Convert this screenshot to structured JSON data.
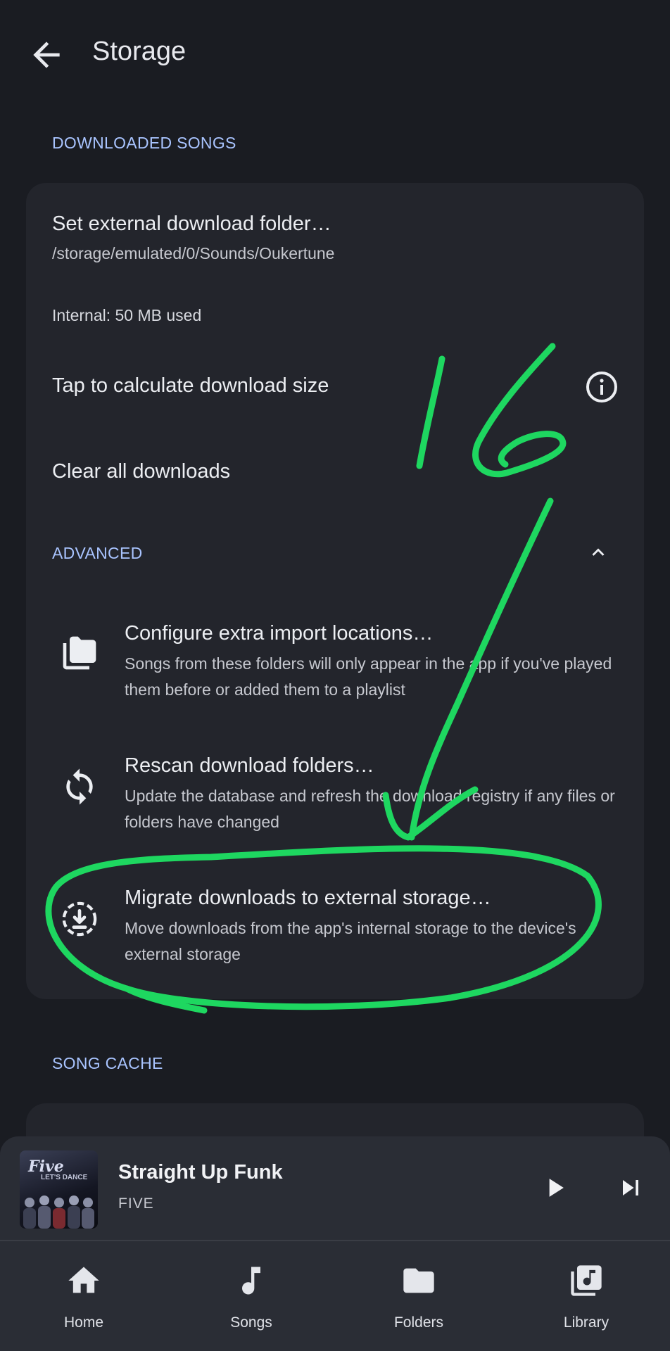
{
  "header": {
    "title": "Storage"
  },
  "downloaded": {
    "section_label": "DOWNLOADED SONGS",
    "folder_title": "Set external download folder…",
    "folder_path": "/storage/emulated/0/Sounds/Oukertune",
    "internal_usage": "Internal: 50 MB used",
    "calc_size": "Tap to calculate download size",
    "clear_all": "Clear all downloads"
  },
  "advanced": {
    "section_label": "ADVANCED",
    "items": [
      {
        "title": "Configure extra import locations…",
        "subtitle": "Songs from these folders will only appear in the app if you've played them before or added them to a playlist",
        "icon": "folders-icon"
      },
      {
        "title": "Rescan download folders…",
        "subtitle": "Update the database and refresh the download registry if any files or folders have changed",
        "icon": "sync-icon"
      },
      {
        "title": "Migrate downloads to external storage…",
        "subtitle": "Move downloads from the app's internal storage to the device's external storage",
        "icon": "download-circle-icon"
      }
    ]
  },
  "cache": {
    "section_label": "SONG CACHE"
  },
  "player": {
    "title": "Straight Up Funk",
    "artist": "FIVE",
    "album_logo": "Five",
    "album_logo_sub": "LET'S DANCE"
  },
  "nav": {
    "items": [
      {
        "label": "Home",
        "icon": "home-icon"
      },
      {
        "label": "Songs",
        "icon": "music-note-icon"
      },
      {
        "label": "Folders",
        "icon": "folder-icon"
      },
      {
        "label": "Library",
        "icon": "library-music-icon"
      }
    ]
  },
  "annotation": {
    "text": "16",
    "color": "#1ed760"
  },
  "colors": {
    "background": "#1a1c22",
    "card": "#23252c",
    "accent": "#a9c4ff",
    "player": "#2a2d35"
  }
}
